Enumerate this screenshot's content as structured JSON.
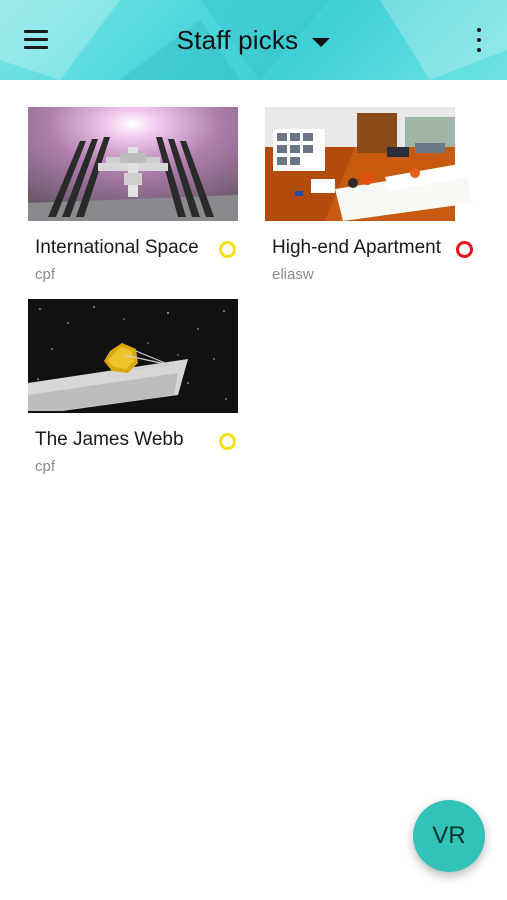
{
  "appbar": {
    "title": "Staff picks",
    "menu_icon": "hamburger-menu-icon",
    "dropdown_icon": "caret-down-icon",
    "more_icon": "more-vert-icon",
    "gradient_colors": [
      "#7ee6e6",
      "#4fd8dc",
      "#3fd0d6"
    ]
  },
  "cards": [
    {
      "title": "International Space",
      "author": "cpf",
      "status_color": "#f5e30f",
      "thumbnail": "space-station-thumbnail"
    },
    {
      "title": "High-end Apartment",
      "author": "eliasw",
      "status_color": "#e8141b",
      "thumbnail": "apartment-thumbnail"
    },
    {
      "title": "The James Webb",
      "author": "cpf",
      "status_color": "#f5e30f",
      "thumbnail": "james-webb-telescope-thumbnail"
    }
  ],
  "fab": {
    "label": "VR",
    "color": "#32c2b8"
  }
}
